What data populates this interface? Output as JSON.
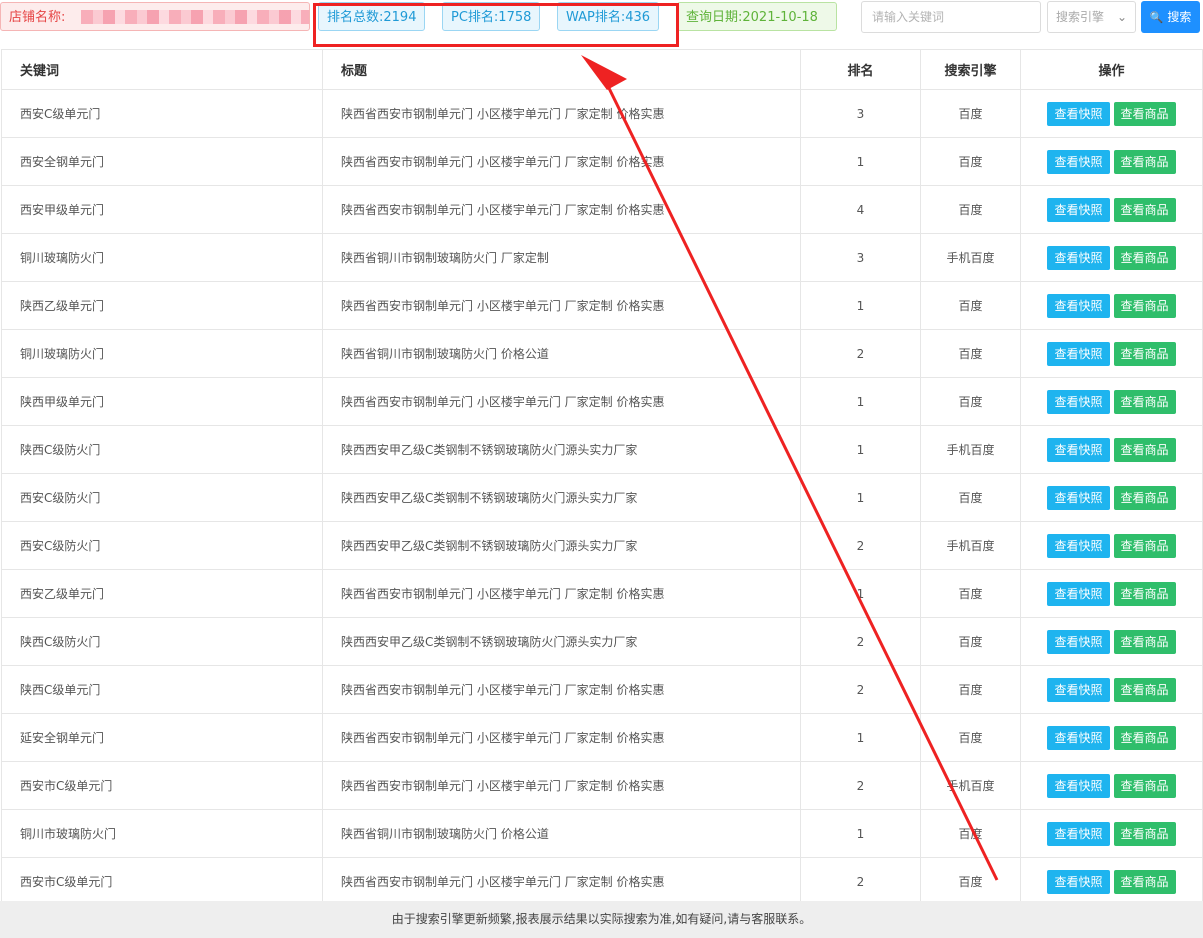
{
  "filters": {
    "shop_label": "店铺名称:",
    "total_rank": "排名总数:2194",
    "pc_rank": "PC排名:1758",
    "wap_rank": "WAP排名:436",
    "query_date": "查询日期:2021-10-18"
  },
  "search": {
    "placeholder": "请输入关键词",
    "engine_placeholder": "搜索引擎",
    "button_label": "搜索"
  },
  "table": {
    "headers": {
      "keyword": "关键词",
      "title": "标题",
      "rank": "排名",
      "engine": "搜索引擎",
      "ops": "操作"
    },
    "snapshot_label": "查看快照",
    "goods_label": "查看商品",
    "rows": [
      {
        "keyword": "西安C级单元门",
        "title": "陕西省西安市钢制单元门 小区楼宇单元门 厂家定制 价格实惠",
        "rank": "3",
        "engine": "百度"
      },
      {
        "keyword": "西安全钢单元门",
        "title": "陕西省西安市钢制单元门 小区楼宇单元门 厂家定制 价格实惠",
        "rank": "1",
        "engine": "百度"
      },
      {
        "keyword": "西安甲级单元门",
        "title": "陕西省西安市钢制单元门 小区楼宇单元门 厂家定制 价格实惠",
        "rank": "4",
        "engine": "百度"
      },
      {
        "keyword": "铜川玻璃防火门",
        "title": "陕西省铜川市钢制玻璃防火门 厂家定制",
        "rank": "3",
        "engine": "手机百度"
      },
      {
        "keyword": "陕西乙级单元门",
        "title": "陕西省西安市钢制单元门 小区楼宇单元门 厂家定制 价格实惠",
        "rank": "1",
        "engine": "百度"
      },
      {
        "keyword": "铜川玻璃防火门",
        "title": "陕西省铜川市钢制玻璃防火门 价格公道",
        "rank": "2",
        "engine": "百度"
      },
      {
        "keyword": "陕西甲级单元门",
        "title": "陕西省西安市钢制单元门 小区楼宇单元门 厂家定制 价格实惠",
        "rank": "1",
        "engine": "百度"
      },
      {
        "keyword": "陕西C级防火门",
        "title": "陕西西安甲乙级C类钢制不锈钢玻璃防火门源头实力厂家",
        "rank": "1",
        "engine": "手机百度"
      },
      {
        "keyword": "西安C级防火门",
        "title": "陕西西安甲乙级C类钢制不锈钢玻璃防火门源头实力厂家",
        "rank": "1",
        "engine": "百度"
      },
      {
        "keyword": "西安C级防火门",
        "title": "陕西西安甲乙级C类钢制不锈钢玻璃防火门源头实力厂家",
        "rank": "2",
        "engine": "手机百度"
      },
      {
        "keyword": "西安乙级单元门",
        "title": "陕西省西安市钢制单元门 小区楼宇单元门 厂家定制 价格实惠",
        "rank": "1",
        "engine": "百度"
      },
      {
        "keyword": "陕西C级防火门",
        "title": "陕西西安甲乙级C类钢制不锈钢玻璃防火门源头实力厂家",
        "rank": "2",
        "engine": "百度"
      },
      {
        "keyword": "陕西C级单元门",
        "title": "陕西省西安市钢制单元门 小区楼宇单元门 厂家定制 价格实惠",
        "rank": "2",
        "engine": "百度"
      },
      {
        "keyword": "延安全钢单元门",
        "title": "陕西省西安市钢制单元门 小区楼宇单元门 厂家定制 价格实惠",
        "rank": "1",
        "engine": "百度"
      },
      {
        "keyword": "西安市C级单元门",
        "title": "陕西省西安市钢制单元门 小区楼宇单元门 厂家定制 价格实惠",
        "rank": "2",
        "engine": "手机百度"
      },
      {
        "keyword": "铜川市玻璃防火门",
        "title": "陕西省铜川市钢制玻璃防火门 价格公道",
        "rank": "1",
        "engine": "百度"
      },
      {
        "keyword": "西安市C级单元门",
        "title": "陕西省西安市钢制单元门 小区楼宇单元门 厂家定制 价格实惠",
        "rank": "2",
        "engine": "百度"
      }
    ]
  },
  "footer": {
    "notice": "由于搜索引擎更新频繁,报表展示结果以实际搜索为准,如有疑问,请与客服联系。"
  },
  "colors": {
    "annotation": "#ee2222",
    "search_button": "#1e90ff",
    "snapshot_button": "#1eb4ef",
    "goods_button": "#2fbe6b"
  }
}
